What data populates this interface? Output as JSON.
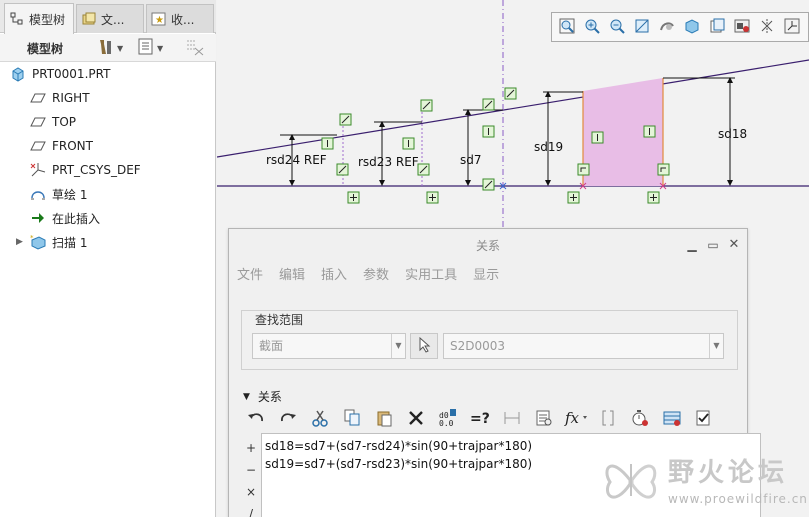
{
  "tabs": [
    {
      "label": "模型树",
      "icon": "model-tree-icon"
    },
    {
      "label": "文...",
      "icon": "folder-browser-icon"
    },
    {
      "label": "收...",
      "icon": "favorites-icon"
    }
  ],
  "tree_toolbar": {
    "title": "模型树"
  },
  "tree": [
    {
      "label": "PRT0001.PRT",
      "icon": "part-icon"
    },
    {
      "label": "RIGHT",
      "icon": "datum-plane-icon"
    },
    {
      "label": "TOP",
      "icon": "datum-plane-icon"
    },
    {
      "label": "FRONT",
      "icon": "datum-plane-icon"
    },
    {
      "label": "PRT_CSYS_DEF",
      "icon": "csys-icon"
    },
    {
      "label": "草绘 1",
      "icon": "sketch-icon"
    },
    {
      "label": "在此插入",
      "icon": "insert-here-arrow-icon"
    },
    {
      "label": "扫描 1",
      "icon": "sweep-feature-icon"
    }
  ],
  "sketch": {
    "dims": [
      "rsd24 REF",
      "rsd23 REF",
      "sd7",
      "sd19",
      "sd18"
    ],
    "fill_color": "#e8bde6",
    "line_color": "#3a1f6e"
  },
  "dialog": {
    "title": "关系",
    "menus": [
      "文件",
      "编辑",
      "插入",
      "参数",
      "实用工具",
      "显示"
    ],
    "scope_label": "查找范围",
    "scope_value": "截面",
    "scope_item": "S2D0003",
    "section_label": "关系",
    "operators": [
      "+",
      "−",
      "×",
      "/"
    ],
    "relations": [
      "sd18=sd7+(sd7-rsd24)*sin(90+trajpar*180)",
      "sd19=sd7+(sd7-rsd23)*sin(90+trajpar*180)"
    ]
  },
  "watermark": {
    "title": "野火论坛",
    "url": "www.proewildfire.cn"
  }
}
